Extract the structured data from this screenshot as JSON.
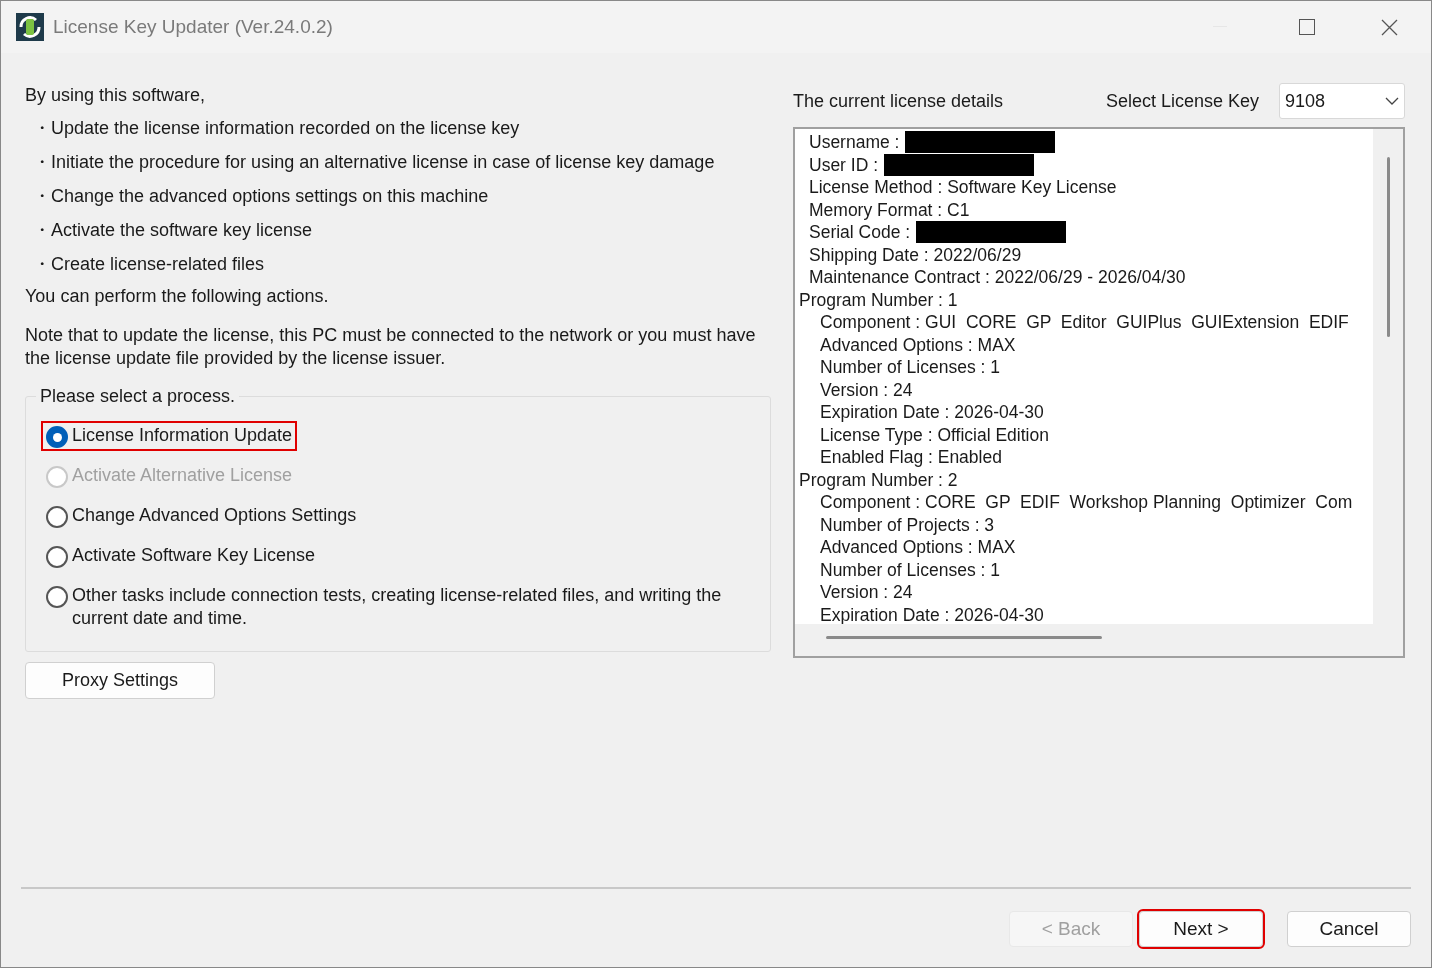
{
  "window": {
    "title": "License Key Updater (Ver.24.0.2)"
  },
  "intro": {
    "heading": "By using this software,",
    "bullets": [
      "・Update the license information recorded on the license key",
      "・Initiate the procedure for using an alternative license in case of license key damage",
      "・Change the advanced options settings on this machine",
      "・Activate the software key license",
      "・Create license-related files"
    ],
    "closing": "You can perform the following actions.",
    "note": "Note that to update the license, this PC must be connected to the network or you must have the license update file provided by the license issuer."
  },
  "process_group": {
    "legend": "Please select a process.",
    "options": [
      {
        "label": "License Information Update",
        "selected": true,
        "disabled": false,
        "highlighted": true
      },
      {
        "label": "Activate Alternative License",
        "selected": false,
        "disabled": true,
        "highlighted": false
      },
      {
        "label": "Change Advanced Options Settings",
        "selected": false,
        "disabled": false,
        "highlighted": false
      },
      {
        "label": "Activate Software Key License",
        "selected": false,
        "disabled": false,
        "highlighted": false
      },
      {
        "label": "Other tasks include connection tests, creating license-related files, and writing the current date and time.",
        "selected": false,
        "disabled": false,
        "highlighted": false
      }
    ]
  },
  "proxy_button": "Proxy Settings",
  "details_panel": {
    "title": "The current license details",
    "select_label": "Select License Key",
    "select_value": "9108",
    "lines": [
      {
        "kind": "field",
        "text": "Username :",
        "redacted": true
      },
      {
        "kind": "field",
        "text": "User ID :",
        "redacted": true
      },
      {
        "kind": "field",
        "text": "License Method : Software Key License",
        "redacted": false
      },
      {
        "kind": "field",
        "text": "Memory Format : C1",
        "redacted": false
      },
      {
        "kind": "field",
        "text": "Serial Code :",
        "redacted": true
      },
      {
        "kind": "field",
        "text": "Shipping Date : 2022/06/29",
        "redacted": false
      },
      {
        "kind": "field",
        "text": "Maintenance Contract : 2022/06/29 - 2026/04/30",
        "redacted": false
      },
      {
        "kind": "group",
        "text": "Program Number : 1",
        "children": [
          "Component : GUI  CORE  GP  Editor  GUIPlus  GUIExtension  EDIF",
          "Advanced Options : MAX",
          "Number of Licenses : 1",
          "Version : 24",
          "Expiration Date : 2026-04-30",
          "License Type : Official Edition",
          "Enabled Flag : Enabled"
        ]
      },
      {
        "kind": "group",
        "text": "Program Number : 2",
        "children": [
          "Component : CORE  GP  EDIF  Workshop Planning  Optimizer  Com",
          "Number of Projects : 3",
          "Advanced Options : MAX",
          "Number of Licenses : 1",
          "Version : 24",
          "Expiration Date : 2026-04-30"
        ]
      }
    ]
  },
  "footer_buttons": [
    {
      "label": "< Back",
      "disabled": true,
      "highlighted": false
    },
    {
      "label": "Next >",
      "disabled": false,
      "highlighted": true
    },
    {
      "label": "Cancel",
      "disabled": false,
      "highlighted": false
    }
  ]
}
